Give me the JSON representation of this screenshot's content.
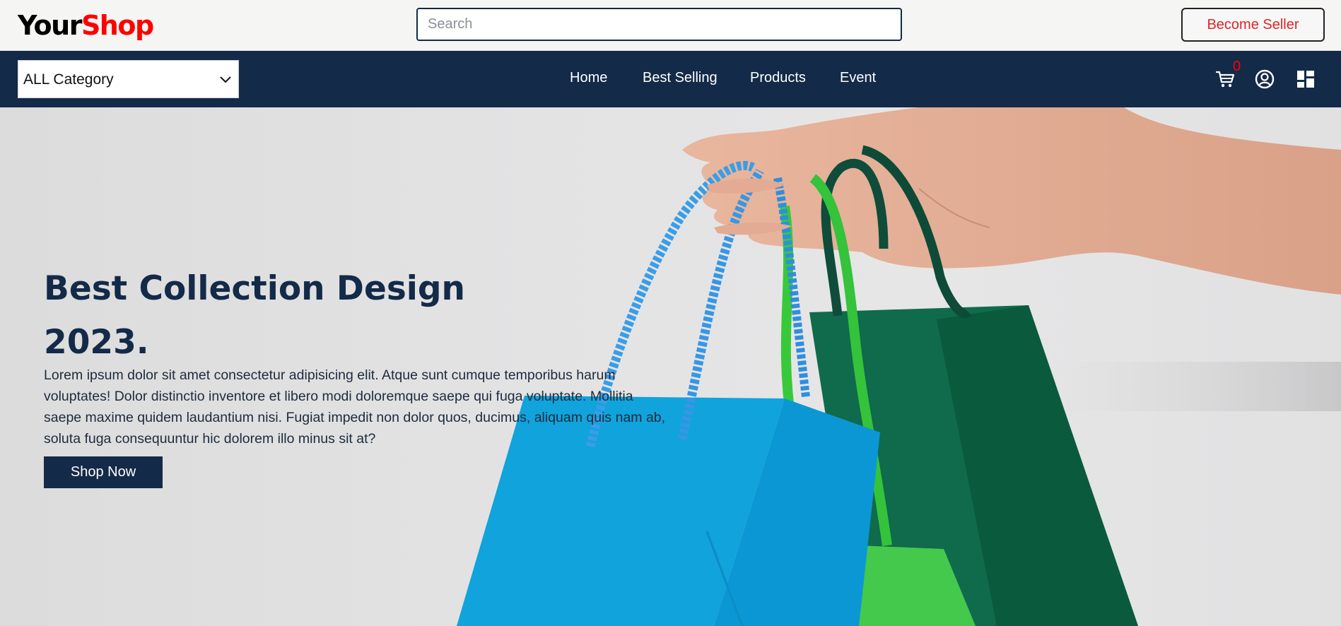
{
  "header": {
    "logo_part1": "Your",
    "logo_part2": "Shop",
    "search_placeholder": "Search",
    "search_value": "",
    "become_seller_label": "Become Seller"
  },
  "navbar": {
    "category_select": {
      "selected": "ALL Category"
    },
    "links": [
      {
        "label": "Home"
      },
      {
        "label": "Best Selling"
      },
      {
        "label": "Products"
      },
      {
        "label": "Event"
      }
    ],
    "icons": [
      "cart-icon",
      "user-icon",
      "dashboard-icon"
    ],
    "cart_count": "0"
  },
  "hero": {
    "title": "Best Collection Design 2023.",
    "description": "Lorem ipsum dolor sit amet consectetur adipisicing elit. Atque sunt cumque temporibus harum voluptates! Dolor distinctio inventore et libero modi doloremque saepe qui fuga voluptate. Mollitia saepe maxime quidem laudantium nisi. Fugiat impedit non dolor quos, ducimus, aliquam quis nam ab, soluta fuga consequuntur hic dolorem illo minus sit at?",
    "cta_label": "Shop Now"
  },
  "colors": {
    "brand_dark": "#132a48",
    "accent_red": "#ff0000",
    "seller_text": "#e02424"
  }
}
